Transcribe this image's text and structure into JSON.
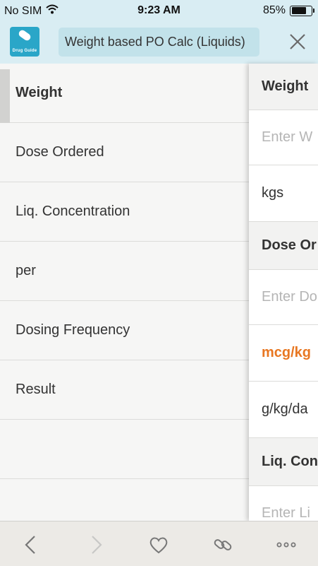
{
  "status": {
    "carrier": "No SIM",
    "time": "9:23 AM",
    "battery": "85%",
    "battery_level": 0.85
  },
  "nav": {
    "app_name": "Drug Guide",
    "title": "Weight based PO Calc (Liquids)"
  },
  "left_items": [
    {
      "label": "Weight"
    },
    {
      "label": "Dose Ordered"
    },
    {
      "label": "Liq. Concentration"
    },
    {
      "label": "per"
    },
    {
      "label": "Dosing Frequency"
    },
    {
      "label": "Result"
    },
    {
      "label": ""
    }
  ],
  "right_panel": {
    "weight_header": "Weight",
    "weight_placeholder": "Enter W",
    "weight_unit": "kgs",
    "dose_header": "Dose Or",
    "dose_placeholder": "Enter Do",
    "dose_unit_selected": "mcg/kg",
    "dose_unit_other": "g/kg/da",
    "conc_header": "Liq. Con",
    "conc_placeholder": "Enter Li"
  },
  "colors": {
    "header_bg": "#d9edf3",
    "accent_orange": "#e87722",
    "app_icon": "#2aa6c8"
  }
}
